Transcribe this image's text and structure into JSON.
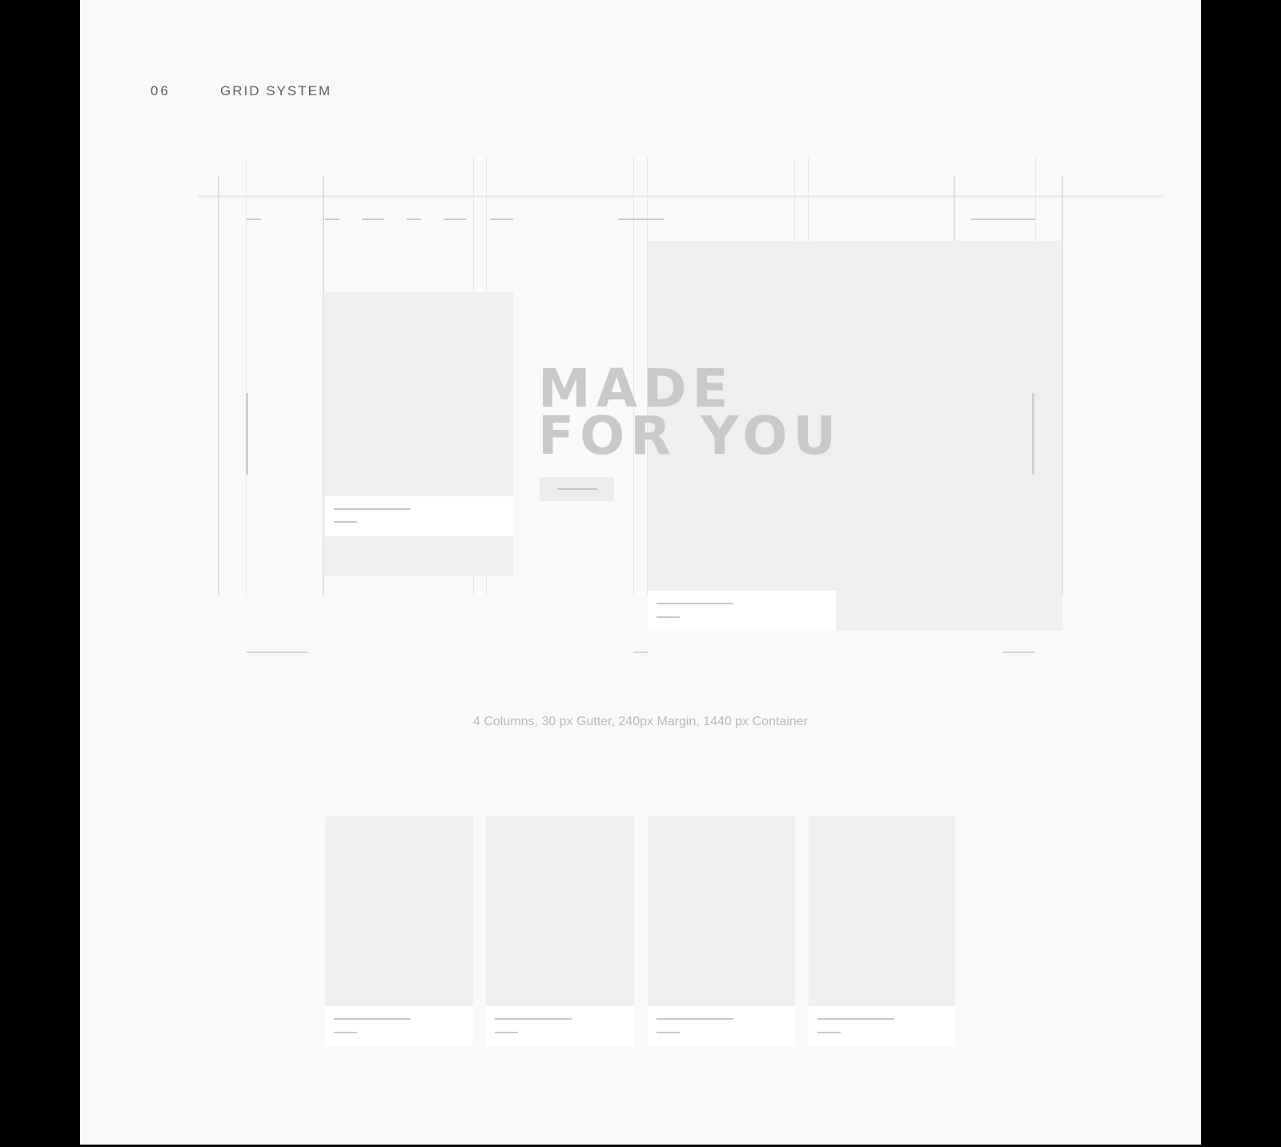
{
  "section": {
    "number": "06",
    "title": "GRID SYSTEM"
  },
  "hero": {
    "title": "MADE\nFOR YOU",
    "button_label": ""
  },
  "caption": "4 Columns, 30 px Gutter, 240px Margin, 1440 px Container",
  "cards": [
    {
      "name": "card-1"
    },
    {
      "name": "card-2"
    },
    {
      "name": "card-3"
    },
    {
      "name": "card-4"
    }
  ],
  "colors": {
    "page_background": "#f9f9f9",
    "placeholder": "#efefef",
    "text_gray": "#5e5e5e",
    "hero_text": "#c9c9c9"
  }
}
